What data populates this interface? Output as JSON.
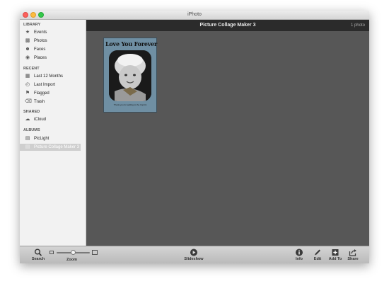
{
  "window": {
    "title": "iPhoto"
  },
  "sidebar": {
    "library": {
      "heading": "LIBRARY",
      "items": [
        {
          "label": "Events",
          "icon": "events-icon"
        },
        {
          "label": "Photos",
          "icon": "photos-icon"
        },
        {
          "label": "Faces",
          "icon": "faces-icon"
        },
        {
          "label": "Places",
          "icon": "places-icon"
        }
      ]
    },
    "recent": {
      "heading": "RECENT",
      "items": [
        {
          "label": "Last 12 Months",
          "icon": "calendar-icon"
        },
        {
          "label": "Last Import",
          "icon": "import-icon"
        },
        {
          "label": "Flagged",
          "icon": "flag-icon"
        },
        {
          "label": "Trash",
          "icon": "trash-icon"
        }
      ]
    },
    "shared": {
      "heading": "SHARED",
      "items": [
        {
          "label": "iCloud",
          "icon": "icloud-icon"
        }
      ]
    },
    "albums": {
      "heading": "ALBUMS",
      "items": [
        {
          "label": "PicLight",
          "icon": "album-icon"
        },
        {
          "label": "Picture Collage Maker 3",
          "icon": "album-icon",
          "selected": true
        }
      ]
    }
  },
  "content": {
    "title": "Picture Collage Maker 3",
    "count": "1 photo",
    "thumbnail": {
      "title": "Love You Forever",
      "caption": "Thank you for adding to the Imprint"
    }
  },
  "toolbar": {
    "search": "Search",
    "zoom": "Zoom",
    "zoom_level": 0.5,
    "slideshow": "Slideshow",
    "info": "Info",
    "edit": "Edit",
    "add_to": "Add To",
    "share": "Share"
  }
}
